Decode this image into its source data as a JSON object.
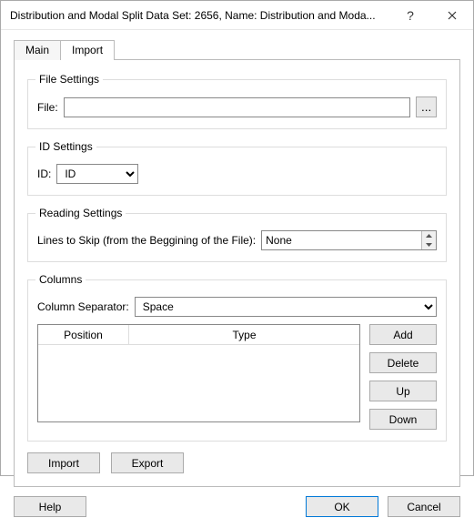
{
  "titlebar": {
    "title": "Distribution and Modal Split Data Set: 2656, Name: Distribution and Moda...",
    "help_symbol": "?",
    "close_label": "Close"
  },
  "tabs": {
    "main": "Main",
    "import": "Import"
  },
  "file_settings": {
    "legend": "File Settings",
    "file_label": "File:",
    "file_value": "",
    "browse_label": "..."
  },
  "id_settings": {
    "legend": "ID Settings",
    "id_label": "ID:",
    "id_value": "ID"
  },
  "reading_settings": {
    "legend": "Reading Settings",
    "lines_label": "Lines to Skip (from the Beggining of the File):",
    "lines_value": "None"
  },
  "columns": {
    "legend": "Columns",
    "sep_label": "Column Separator:",
    "sep_value": "Space",
    "th_position": "Position",
    "th_type": "Type",
    "add": "Add",
    "delete": "Delete",
    "up": "Up",
    "down": "Down"
  },
  "actions": {
    "import": "Import",
    "export": "Export"
  },
  "footer": {
    "help": "Help",
    "ok": "OK",
    "cancel": "Cancel"
  }
}
